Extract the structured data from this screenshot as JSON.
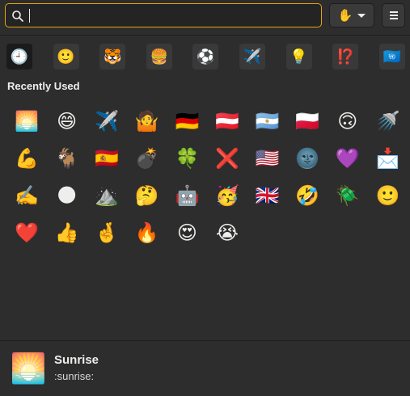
{
  "search": {
    "value": "",
    "placeholder": ""
  },
  "skin_tone_button": {
    "emoji": "✋",
    "icon": "chevron-down-icon"
  },
  "menu_button": {
    "icon": "hamburger-menu-icon"
  },
  "categories": [
    {
      "emoji": "🕘",
      "name": "recent",
      "active": true
    },
    {
      "emoji": "🙂",
      "name": "smileys"
    },
    {
      "emoji": "🐯",
      "name": "animals"
    },
    {
      "emoji": "🍔",
      "name": "food"
    },
    {
      "emoji": "⚽",
      "name": "activities"
    },
    {
      "emoji": "✈️",
      "name": "travel"
    },
    {
      "emoji": "💡",
      "name": "objects"
    },
    {
      "emoji": "⁉️",
      "name": "symbols"
    },
    {
      "emoji": "🇺🇳",
      "name": "flags"
    }
  ],
  "section_title": "Recently Used",
  "emojis": [
    "🌅",
    "😄",
    "✈️",
    "🤷",
    "🇩🇪",
    "🇦🇹",
    "🇦🇷",
    "🇵🇱",
    "🙃",
    "🚿",
    "💪",
    "🐐",
    "🇪🇸",
    "💣",
    "🍀",
    "❌",
    "🇺🇸",
    "🌚",
    "💜",
    "📩",
    "✍️",
    "🌑",
    "⛰️",
    "🤔",
    "🤖",
    "🥳",
    "🇬🇧",
    "🤣",
    "🪲",
    "🙂",
    "❤️",
    "👍",
    "🤞",
    "🔥",
    "😍",
    "😭"
  ],
  "preview": {
    "emoji": "🌅",
    "name": "Sunrise",
    "shortcode": ":sunrise:"
  }
}
